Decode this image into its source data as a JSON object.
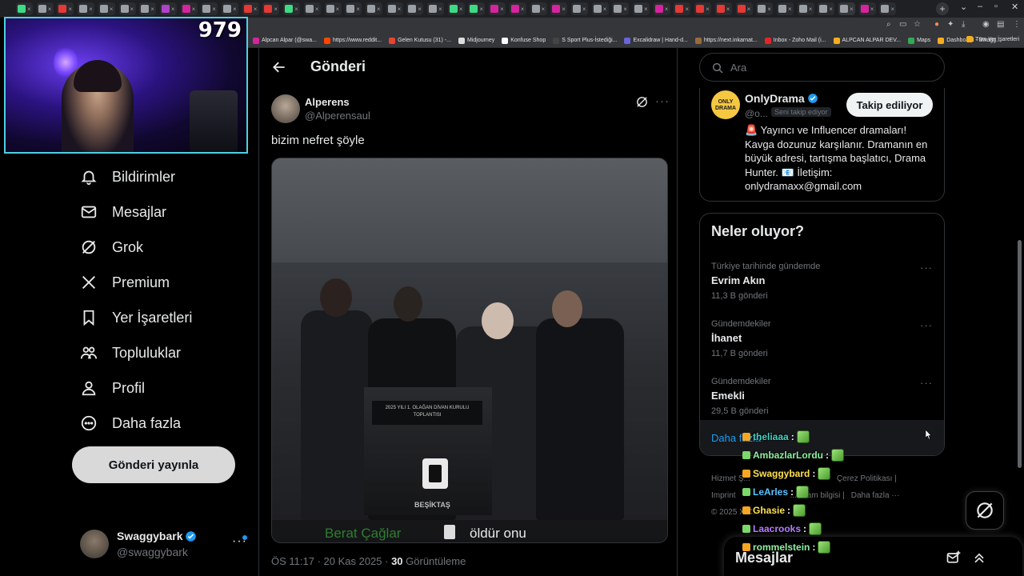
{
  "viewer_count": "979",
  "browser": {
    "tabs_count_hint": "many",
    "bookmarks": [
      {
        "label": "Alpcan Alpar (@swa..."
      },
      {
        "label": "https://www.reddit..."
      },
      {
        "label": "Gelen Kutusu (31) -..."
      },
      {
        "label": "Midjourney"
      },
      {
        "label": "Konfuse Shop"
      },
      {
        "label": "S Sport Plus-İstediği..."
      },
      {
        "label": "Excalidraw | Hand-d..."
      },
      {
        "label": "https://next.inkarnat..."
      },
      {
        "label": "Inbox - Zoho Mail (i..."
      },
      {
        "label": "ALPCAN ALPAR DEV..."
      },
      {
        "label": "Maps"
      },
      {
        "label": "Dashboard - Swagg..."
      }
    ],
    "all_bookmarks": "Tüm Yer İşaretleri"
  },
  "nav": {
    "items": [
      {
        "label": "Bildirimler",
        "icon": "bell-icon"
      },
      {
        "label": "Mesajlar",
        "icon": "mail-icon"
      },
      {
        "label": "Grok",
        "icon": "grok-icon"
      },
      {
        "label": "Premium",
        "icon": "x-logo-icon"
      },
      {
        "label": "Yer İşaretleri",
        "icon": "bookmark-icon"
      },
      {
        "label": "Topluluklar",
        "icon": "communities-icon"
      },
      {
        "label": "Profil",
        "icon": "person-icon"
      },
      {
        "label": "Daha fazla",
        "icon": "more-circle-icon"
      }
    ],
    "post_button": "Gönderi yayınla",
    "account": {
      "name": "Swaggybark",
      "handle": "@swaggybark"
    }
  },
  "main": {
    "title": "Gönderi",
    "post": {
      "author": "Alperens",
      "handle": "@Alperensaul",
      "text": "bizim nefret şöyle",
      "video": {
        "subtitle_name": "Berat Çağlar",
        "subtitle_text": "öldür onu",
        "podium_sign": "2025 YILI 1. OLAĞAN DİVAN KURULU TOPLANTISI",
        "podium_label": "BEŞİKTAŞ"
      },
      "time": "ÖS 11:17 · 20 Kas 2025 · ",
      "views_count": "30",
      "views_label": " Görüntüleme"
    }
  },
  "right": {
    "search_placeholder": "Ara",
    "profile_card": {
      "avatar_text": "ONLY DRAMA",
      "name": "OnlyDrama",
      "handle": "@o...",
      "follows_you": "Seni takip ediyor",
      "follow_button": "Takip ediliyor",
      "bio": "🚨 Yayıncı ve Influencer dramaları! Kavga dozunuz karşılanır. Dramanın en büyük adresi, tartışma başlatıcı, Drama Hunter. 📧 İletişim: onlydramaxx@gmail.com"
    },
    "trends": {
      "title": "Neler oluyor?",
      "items": [
        {
          "context": "Türkiye tarihinde gündemde",
          "name": "Evrim Akın",
          "count": "11,3 B gönderi"
        },
        {
          "context": "Gündemdekiler",
          "name": "İhanet",
          "count": "11,7 B gönderi"
        },
        {
          "context": "Gündemdekiler",
          "name": "Emekli",
          "count": "29,5 B gönderi"
        }
      ],
      "show_more": "Daha fazla"
    },
    "footer": {
      "row1": [
        "Hizmet Ş...",
        "Çerez Politikası |"
      ],
      "row2": [
        "Imprint",
        "...eklam bilgisi |",
        "Daha fazla ···"
      ],
      "row3": [
        "© 2025 X C..."
      ]
    },
    "messages_drawer": "Mesajlar"
  },
  "chat": [
    {
      "user": "theliaaa",
      "color": "#41d6c3"
    },
    {
      "user": "AmbazlarLordu",
      "color": "#8ef0a2"
    },
    {
      "user": "Swaggybard",
      "color": "#ffe14d"
    },
    {
      "user": "LeArles",
      "color": "#59c3ff"
    },
    {
      "user": "Ghasie",
      "color": "#ffe14d"
    },
    {
      "user": "Laacrooks",
      "color": "#b57cff"
    },
    {
      "user": "rommelstein",
      "color": "#8ef0a2"
    }
  ],
  "colors": {
    "accent": "#1d9bf0",
    "background": "#000000",
    "text": "#e7e9ea",
    "muted": "#71767b",
    "webcam_border": "#4dd0e1"
  }
}
